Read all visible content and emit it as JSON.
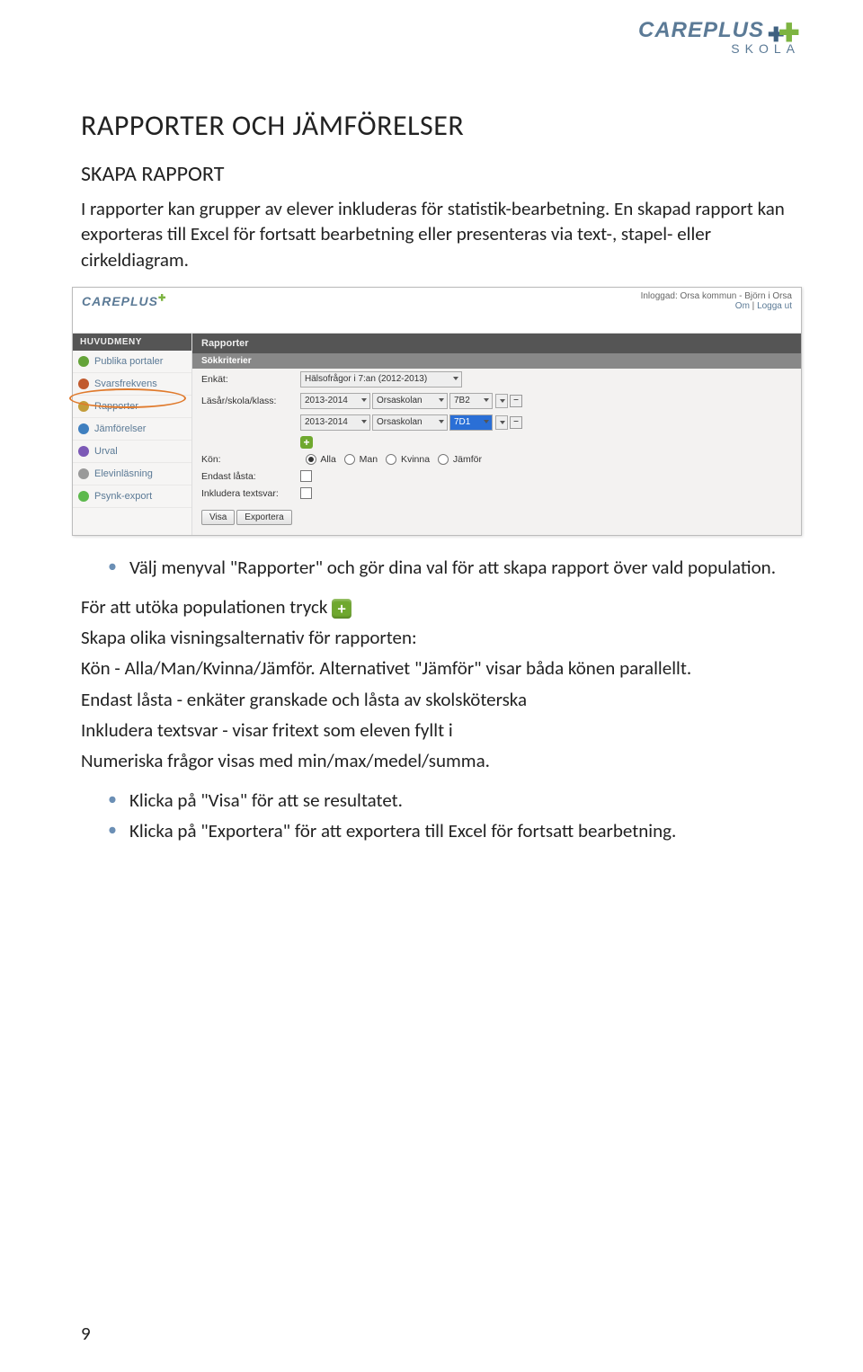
{
  "brand": {
    "name": "CAREPLUS",
    "subtitle": "SKOLA"
  },
  "title": "RAPPORTER OCH JÄMFÖRELSER",
  "subtitle": "SKAPA RAPPORT",
  "intro": "I rapporter kan grupper av elever inkluderas för statistik-bearbetning. En skapad rapport kan exporteras till Excel för fortsatt bearbetning eller presenteras via text-, stapel- eller cirkeldiagram.",
  "app": {
    "logged_in": "Inloggad: Orsa kommun - Björn i Orsa",
    "menu_links": {
      "om": "Om",
      "logout": "Logga ut"
    },
    "sidehead": "HUVUDMENY",
    "menu": [
      {
        "icon": "#64a338",
        "label": "Publika portaler"
      },
      {
        "icon": "#c15a2e",
        "label": "Svarsfrekvens"
      },
      {
        "icon": "#c39d3a",
        "label": "Rapporter"
      },
      {
        "icon": "#3f7fbf",
        "label": "Jämförelser"
      },
      {
        "icon": "#7c59b6",
        "label": "Urval"
      },
      {
        "icon": "#999999",
        "label": "Elevinläsning"
      },
      {
        "icon": "#5db94d",
        "label": "Psynk-export"
      }
    ],
    "tab_title": "Rapporter",
    "sub_title": "Sökkriterier",
    "form": {
      "enkat_label": "Enkät:",
      "enkat_value": "Hälsofrågor i 7:an (2012-2013)",
      "lasar_label": "Läsår/skola/klass:",
      "rows": [
        {
          "year": "2013-2014",
          "school": "Orsaskolan",
          "klass": "7B2",
          "hilite": false
        },
        {
          "year": "2013-2014",
          "school": "Orsaskolan",
          "klass": "7D1",
          "hilite": true
        }
      ],
      "kon_label": "Kön:",
      "kon_options": [
        "Alla",
        "Man",
        "Kvinna",
        "Jämför"
      ],
      "kon_selected": 0,
      "endast_label": "Endast låsta:",
      "inkludera_label": "Inkludera textsvar:",
      "btn_visa": "Visa",
      "btn_exportera": "Exportera"
    }
  },
  "bullet1": "Välj menyval \"Rapporter\" och gör dina val för att skapa rapport över vald population.",
  "line_popu": "För att utöka populationen tryck",
  "line_skapa": "Skapa olika visningsalternativ för rapporten:",
  "line_kon": "Kön - Alla/Man/Kvinna/Jämför. Alternativet \"Jämför\" visar båda könen parallellt.",
  "line_endast": "Endast låsta - enkäter granskade och låsta av skolsköterska",
  "line_inkludera": "Inkludera textsvar - visar fritext som eleven fyllt i",
  "line_numeriska": "Numeriska frågor visas med min/max/medel/summa.",
  "bullet_visa": "Klicka på \"Visa\" för att se resultatet.",
  "bullet_export": "Klicka på \"Exportera\" för att exportera till Excel för fortsatt bearbetning.",
  "page_number": "9"
}
